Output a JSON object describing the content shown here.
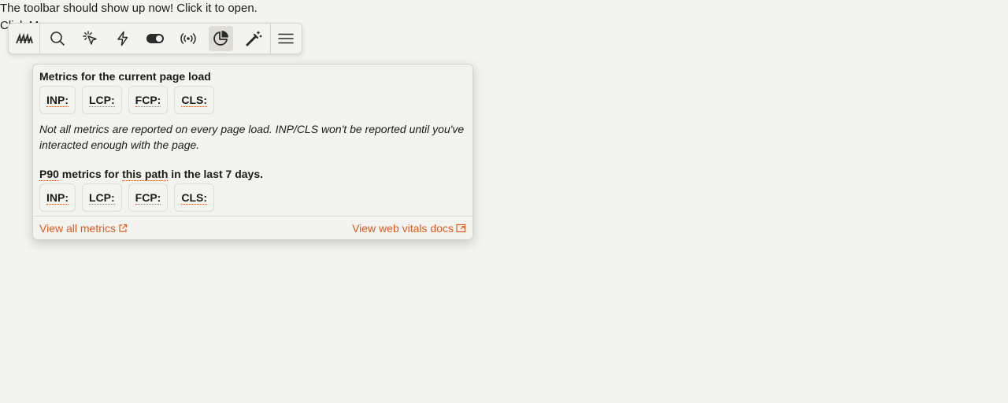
{
  "page": {
    "intro_text": "The toolbar should show up now! Click it to open.",
    "click_text": "Click Me"
  },
  "toolbar": {
    "logo_icon": "sentry-logo-icon",
    "buttons": [
      {
        "icon": "search-icon",
        "active": false
      },
      {
        "icon": "cursor-click-icon",
        "active": false
      },
      {
        "icon": "lightning-icon",
        "active": false
      },
      {
        "icon": "toggle-icon",
        "active": false
      },
      {
        "icon": "broadcast-icon",
        "active": false
      },
      {
        "icon": "pie-chart-icon",
        "active": true
      },
      {
        "icon": "magic-wand-icon",
        "active": false
      }
    ],
    "menu_icon": "hamburger-menu-icon"
  },
  "panel": {
    "current_title": "Metrics for the current page load",
    "current_metrics": [
      "INP:",
      "LCP:",
      "FCP:",
      "CLS:"
    ],
    "note": "Not all metrics are reported on every page load. INP/CLS won't be reported until you've interacted enough with the page.",
    "p90_title": {
      "part1": "P90",
      "part2": " metrics for ",
      "part3": "this path",
      "part4": " in the last 7 days."
    },
    "p90_metrics": [
      "INP:",
      "LCP:",
      "FCP:",
      "CLS:"
    ],
    "link_all": "View all metrics",
    "link_docs": "View web vitals docs"
  },
  "colors": {
    "accent": "#e05a1e",
    "background": "#f3f3ef",
    "active_button": "#dedcd5"
  }
}
